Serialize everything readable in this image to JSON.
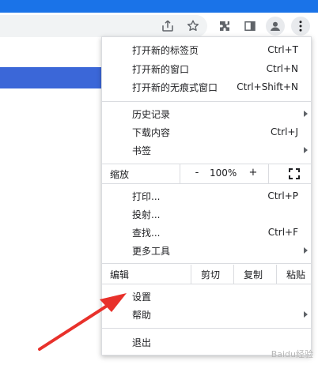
{
  "colors": {
    "accent": "#1a73e8",
    "page_blue": "#3b67d8",
    "arrow": "#e8312b"
  },
  "toolbar": {
    "icons": [
      "share-icon",
      "star-icon",
      "extensions-icon",
      "sidebar-icon",
      "profile-icon",
      "kebab-menu-icon"
    ]
  },
  "menu": {
    "items": [
      {
        "label": "打开新的标签页",
        "shortcut": "Ctrl+T"
      },
      {
        "label": "打开新的窗口",
        "shortcut": "Ctrl+N"
      },
      {
        "label": "打开新的无痕式窗口",
        "shortcut": "Ctrl+Shift+N"
      },
      {
        "label": "历史记录",
        "shortcut": ""
      },
      {
        "label": "下载内容",
        "shortcut": "Ctrl+J"
      },
      {
        "label": "书签",
        "shortcut": ""
      },
      {
        "label": "打印...",
        "shortcut": "Ctrl+P"
      },
      {
        "label": "投射...",
        "shortcut": ""
      },
      {
        "label": "查找...",
        "shortcut": "Ctrl+F"
      },
      {
        "label": "更多工具",
        "shortcut": ""
      },
      {
        "label": "设置",
        "shortcut": ""
      },
      {
        "label": "帮助",
        "shortcut": ""
      },
      {
        "label": "退出",
        "shortcut": ""
      }
    ],
    "zoom": {
      "label": "缩放",
      "minus": "-",
      "value": "100%",
      "plus": "+"
    },
    "edit": {
      "label": "编辑",
      "cut": "剪切",
      "copy": "复制",
      "paste": "粘贴"
    }
  },
  "watermark": "Baidu经验"
}
